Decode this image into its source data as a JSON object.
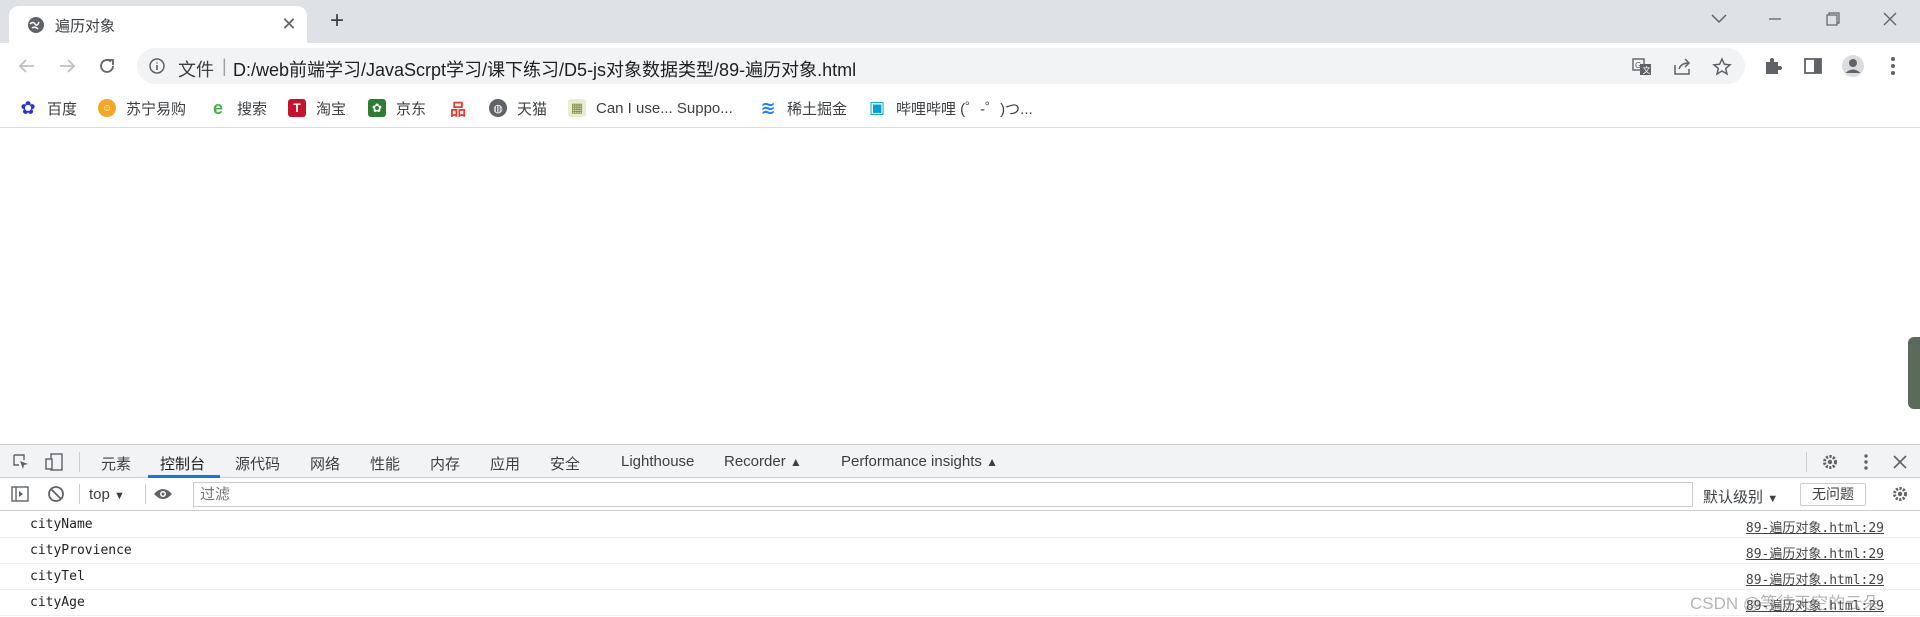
{
  "browser": {
    "tab": {
      "title": "遍历对象",
      "favicon": "globe-icon"
    },
    "address": {
      "scheme_label": "文件",
      "url": "D:/web前端学习/JavaScrpt学习/课下练习/D5-js对象数据类型/89-遍历对象.html"
    },
    "bookmarks": [
      {
        "label": "百度",
        "icon": "baidu-icon",
        "color": "#2932e1",
        "glyph": "✿"
      },
      {
        "label": "苏宁易购",
        "icon": "suning-icon",
        "color": "#f5a623",
        "glyph": "●"
      },
      {
        "label": "搜索",
        "icon": "search-engine-icon",
        "color": "#4caf50",
        "glyph": "e"
      },
      {
        "label": "淘宝",
        "icon": "taobao-icon",
        "color": "#c41230",
        "glyph": "T"
      },
      {
        "label": "京东",
        "icon": "jd-icon",
        "color": "#2e7d32",
        "glyph": "✿"
      },
      {
        "label": "",
        "icon": "grid-logo-icon",
        "color": "#e53935",
        "glyph": "品"
      },
      {
        "label": "天猫",
        "icon": "globe-icon",
        "color": "#5f6368",
        "glyph": "◉"
      },
      {
        "label": "Can I use... Suppo...",
        "icon": "caniuse-icon",
        "color": "#7a8a3a",
        "glyph": "▦"
      },
      {
        "label": "稀土掘金",
        "icon": "juejin-icon",
        "color": "#1e80ff",
        "glyph": "≋"
      },
      {
        "label": "哔哩哔哩 (゜-゜)つ...",
        "icon": "bilibili-icon",
        "color": "#00a1d6",
        "glyph": "▣"
      }
    ]
  },
  "devtools": {
    "tabs": [
      "元素",
      "控制台",
      "源代码",
      "网络",
      "性能",
      "内存",
      "应用",
      "安全",
      "Lighthouse",
      "Recorder",
      "Performance insights"
    ],
    "active_tab": "控制台",
    "console": {
      "context": "top",
      "filter_placeholder": "过滤",
      "levels": "默认级别",
      "issues": "无问题",
      "messages": [
        {
          "text": "cityName",
          "source": "89-遍历对象.html:29"
        },
        {
          "text": "cityProvience",
          "source": "89-遍历对象.html:29"
        },
        {
          "text": "cityTel",
          "source": "89-遍历对象.html:29"
        },
        {
          "text": "cityAge",
          "source": "89-遍历对象.html:29"
        }
      ]
    }
  },
  "watermark": "CSDN @等待天空的云朵"
}
